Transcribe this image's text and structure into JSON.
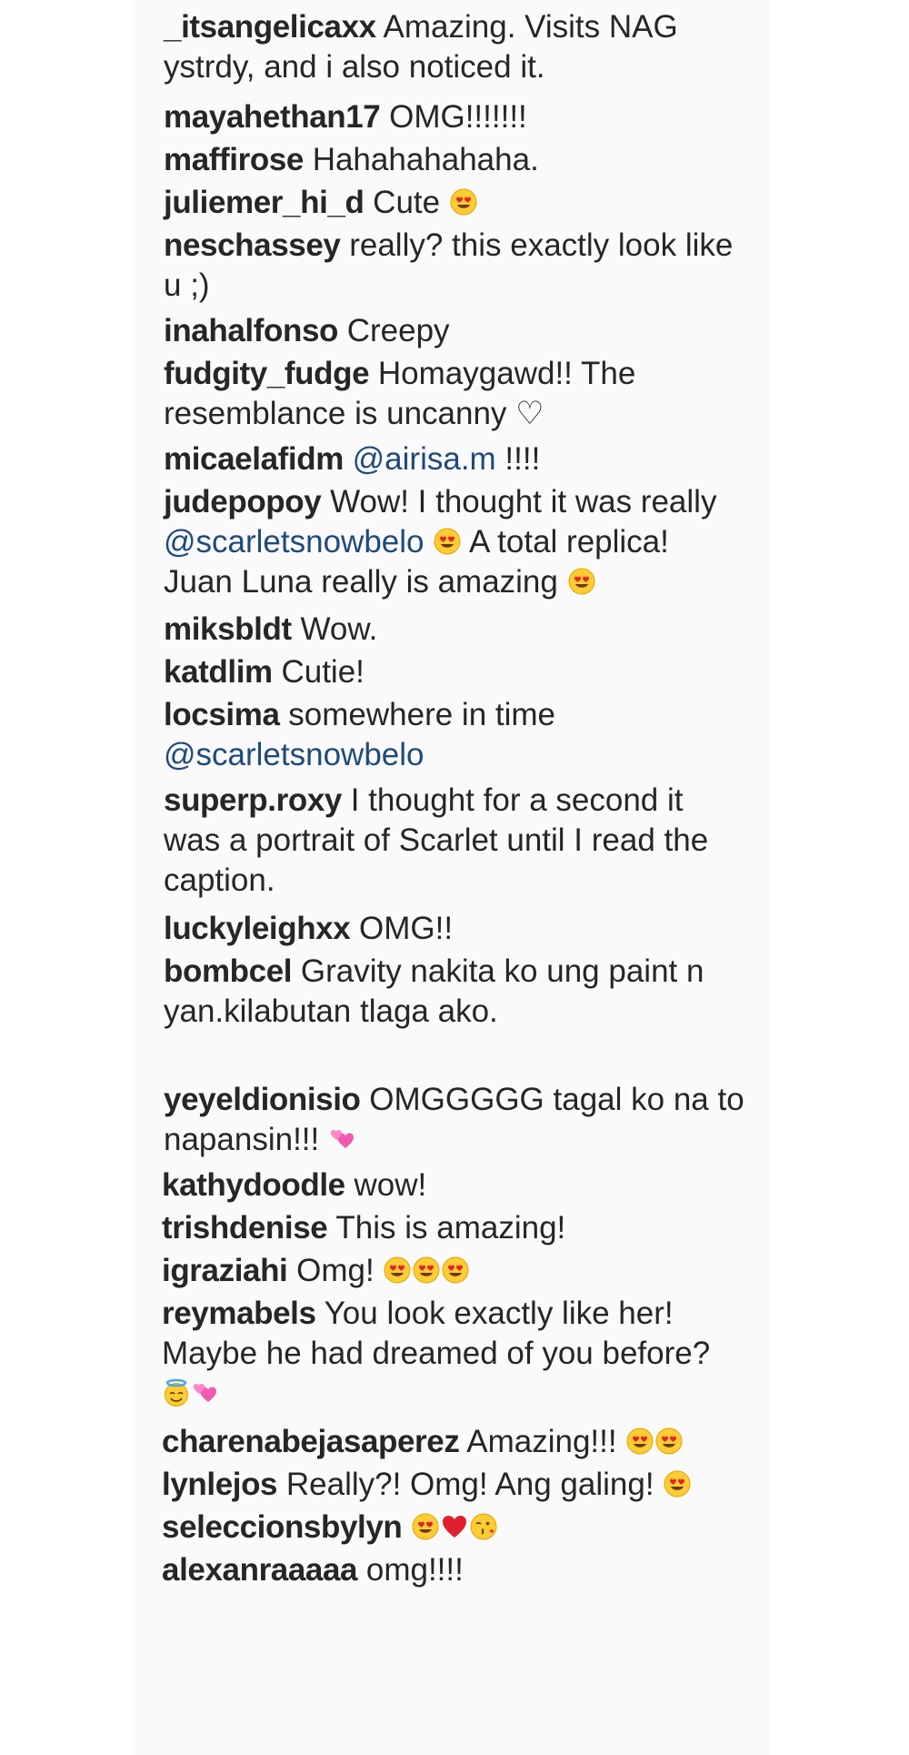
{
  "comments": [
    {
      "username": "_itsangelicaxx",
      "parts": [
        {
          "t": "Amazing. Visits NAG ystrdy, and i also noticed it."
        }
      ]
    },
    {
      "username": "mayahethan17",
      "parts": [
        {
          "t": "OMG!!!!!!!"
        }
      ]
    },
    {
      "username": "maffirose",
      "parts": [
        {
          "t": "Hahahahahaha."
        }
      ]
    },
    {
      "username": "juliemer_hi_d",
      "parts": [
        {
          "t": "Cute "
        },
        {
          "e": "heart-eyes"
        }
      ]
    },
    {
      "username": "neschassey",
      "parts": [
        {
          "t": "really? this exactly look like u ;)"
        }
      ]
    },
    {
      "username": "inahalfonso",
      "parts": [
        {
          "t": "Creepy"
        }
      ]
    },
    {
      "username": "fudgity_fudge",
      "parts": [
        {
          "t": "Homaygawd!! The resemblance is uncanny ♡"
        }
      ]
    },
    {
      "username": "micaelafidm",
      "parts": [
        {
          "m": "@airisa.m"
        },
        {
          "t": " !!!!"
        }
      ]
    },
    {
      "username": "judepopoy",
      "parts": [
        {
          "t": "Wow! I thought it was really "
        },
        {
          "m": "@scarletsnowbelo"
        },
        {
          "t": " "
        },
        {
          "e": "heart-eyes"
        },
        {
          "t": " A total replica! Juan Luna really is amazing "
        },
        {
          "e": "heart-eyes"
        }
      ]
    },
    {
      "username": "miksbldt",
      "parts": [
        {
          "t": "Wow."
        }
      ]
    },
    {
      "username": "katdlim",
      "parts": [
        {
          "t": "Cutie!"
        }
      ]
    },
    {
      "username": "locsima",
      "parts": [
        {
          "t": "somewhere in time "
        },
        {
          "m": "@scarletsnowbelo"
        }
      ]
    },
    {
      "username": "superp.roxy",
      "parts": [
        {
          "t": "I thought for a second it was a portrait of Scarlet until I read the caption."
        }
      ]
    },
    {
      "username": "luckyleighxx",
      "parts": [
        {
          "t": "OMG!!"
        }
      ]
    },
    {
      "username": "bombcel",
      "parts": [
        {
          "t": "Gravity nakita ko ung paint n yan.kilabutan tlaga ako."
        }
      ]
    },
    {
      "username": "yeyeldionisio",
      "parts": [
        {
          "t": "OMGGGGG tagal ko na to napansin!!! "
        },
        {
          "e": "two-hearts"
        }
      ]
    },
    {
      "username": "kathydoodle",
      "parts": [
        {
          "t": "wow!"
        }
      ]
    },
    {
      "username": "trishdenise",
      "parts": [
        {
          "t": "This is amazing!"
        }
      ]
    },
    {
      "username": "igraziahi",
      "parts": [
        {
          "t": "Omg! "
        },
        {
          "e": "heart-eyes"
        },
        {
          "e": "heart-eyes"
        },
        {
          "e": "heart-eyes"
        }
      ]
    },
    {
      "username": "reymabels",
      "parts": [
        {
          "t": "You look exactly like her! Maybe he had dreamed of you before? "
        },
        {
          "e": "halo"
        },
        {
          "e": "two-hearts"
        }
      ]
    },
    {
      "username": "charenabejasaperez",
      "parts": [
        {
          "t": "Amazing!!! "
        },
        {
          "e": "heart-eyes"
        },
        {
          "e": "heart-eyes"
        }
      ]
    },
    {
      "username": "lynlejos",
      "parts": [
        {
          "t": "Really?! Omg! Ang galing! "
        },
        {
          "e": "heart-eyes"
        }
      ]
    },
    {
      "username": "seleccionsbylyn",
      "parts": [
        {
          "e": "heart-eyes"
        },
        {
          "e": "red-heart"
        },
        {
          "e": "kiss"
        }
      ]
    },
    {
      "username": "alexanraaaaa",
      "parts": [
        {
          "t": "omg!!!!"
        }
      ]
    }
  ],
  "colors": {
    "background": "#fafafa",
    "text": "#262626",
    "mention": "#1f4a7c"
  }
}
